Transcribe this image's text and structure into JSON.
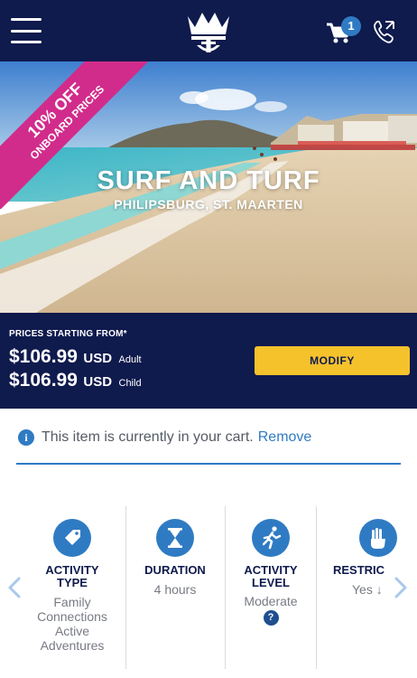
{
  "header": {
    "menu_icon": "hamburger-menu-icon",
    "logo_icon": "crown-anchor-logo",
    "cart_icon": "shopping-cart-icon",
    "cart_count": "1",
    "phone_icon": "phone-call-icon",
    "bg_color": "#0f1a4d"
  },
  "hero": {
    "promo_line1": "10% OFF",
    "promo_line2": "ONBOARD PRICES",
    "title": "SURF AND TURF",
    "location": "PHILIPSBURG, ST. MAARTEN"
  },
  "pricing": {
    "label": "PRICES STARTING FROM*",
    "adult_amount": "$106.99",
    "adult_currency": "USD",
    "adult_label": "Adult",
    "child_amount": "$106.99",
    "child_currency": "USD",
    "child_label": "Child",
    "modify_label": "MODIFY"
  },
  "cart_notice": {
    "message": "This item is currently in your cart.",
    "remove_label": "Remove"
  },
  "features": [
    {
      "title_line1": "ACTIVITY",
      "title_line2": "TYPE",
      "value_lines": [
        "Family",
        "Connections",
        "Active",
        "Adventures"
      ],
      "icon": "tag-icon"
    },
    {
      "title_line1": "DURATION",
      "title_line2": "",
      "value_lines": [
        "4 hours"
      ],
      "icon": "hourglass-icon"
    },
    {
      "title_line1": "ACTIVITY",
      "title_line2": "LEVEL",
      "value_lines": [
        "Moderate"
      ],
      "help": "?",
      "icon": "running-person-icon"
    },
    {
      "title_line1": "RESTRIC",
      "title_line2": "",
      "value_lines": [
        "Yes ↓"
      ],
      "icon": "hand-icon"
    }
  ],
  "colors": {
    "accent": "#2f7bc3",
    "brand_navy": "#0f1a4d",
    "button_yellow": "#f5c22c",
    "promo_pink": "#d12c8b"
  }
}
